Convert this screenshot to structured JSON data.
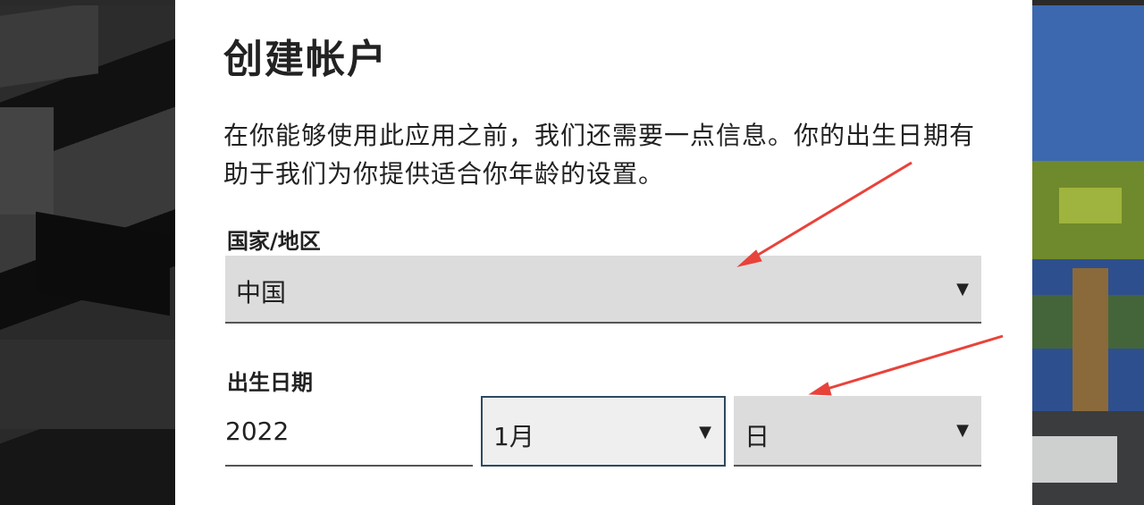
{
  "dialog": {
    "title": "创建帐户",
    "description": "在你能够使用此应用之前，我们还需要一点信息。你的出生日期有助于我们为你提供适合你年龄的设置。"
  },
  "country": {
    "label": "国家/地区",
    "value": "中国",
    "arrow": "▼"
  },
  "birth_date": {
    "label": "出生日期",
    "year": "2022",
    "month": "1月",
    "day": "日",
    "arrow": "▼"
  },
  "colors": {
    "annotation_arrow": "#e8433a",
    "field_bg": "#dcdcdc",
    "focus_border": "#2d4a60"
  }
}
